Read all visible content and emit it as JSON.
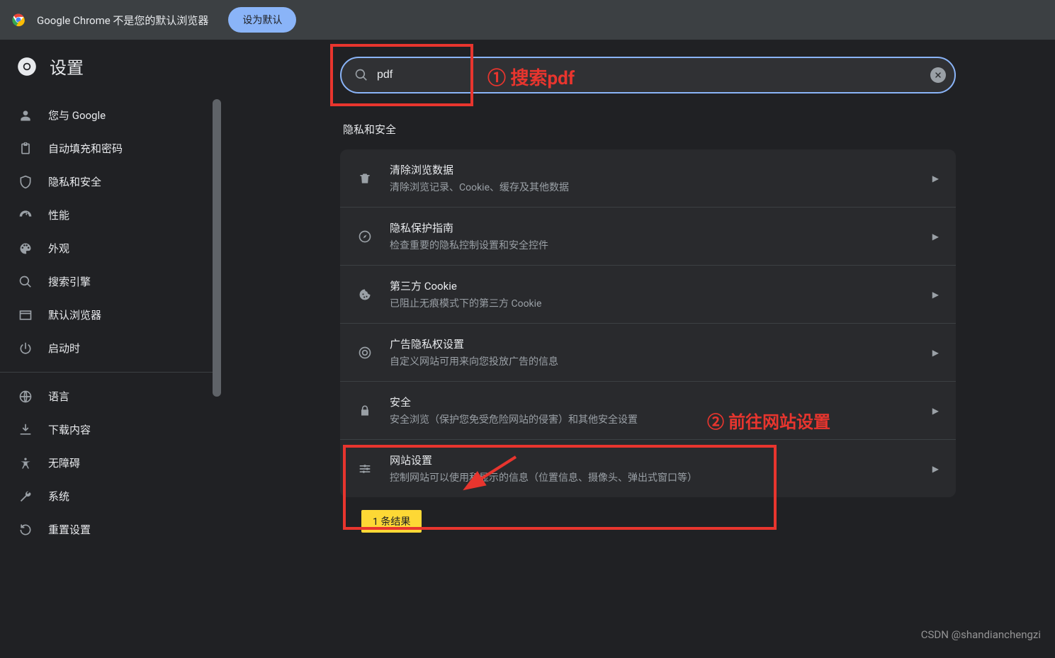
{
  "banner": {
    "text": "Google Chrome 不是您的默认浏览器",
    "button": "设为默认"
  },
  "header": {
    "title": "设置"
  },
  "sidebar": {
    "groupA": [
      {
        "icon": "person",
        "label": "您与 Google"
      },
      {
        "icon": "clipboard",
        "label": "自动填充和密码"
      },
      {
        "icon": "shield",
        "label": "隐私和安全"
      },
      {
        "icon": "gauge",
        "label": "性能"
      },
      {
        "icon": "palette",
        "label": "外观"
      },
      {
        "icon": "search",
        "label": "搜索引擎"
      },
      {
        "icon": "window",
        "label": "默认浏览器"
      },
      {
        "icon": "power",
        "label": "启动时"
      }
    ],
    "groupB": [
      {
        "icon": "globe",
        "label": "语言"
      },
      {
        "icon": "download",
        "label": "下载内容"
      },
      {
        "icon": "accessibility",
        "label": "无障碍"
      },
      {
        "icon": "wrench",
        "label": "系统"
      },
      {
        "icon": "reset",
        "label": "重置设置"
      }
    ]
  },
  "search": {
    "value": "pdf",
    "placeholder": ""
  },
  "section": {
    "title": "隐私和安全"
  },
  "rows": [
    {
      "icon": "trash",
      "title": "清除浏览数据",
      "sub": "清除浏览记录、Cookie、缓存及其他数据"
    },
    {
      "icon": "compass",
      "title": "隐私保护指南",
      "sub": "检查重要的隐私控制设置和安全控件"
    },
    {
      "icon": "cookie",
      "title": "第三方 Cookie",
      "sub": "已阻止无痕模式下的第三方 Cookie"
    },
    {
      "icon": "ads",
      "title": "广告隐私权设置",
      "sub": "自定义网站可用来向您投放广告的信息"
    },
    {
      "icon": "lock",
      "title": "安全",
      "sub": "安全浏览（保护您免受危险网站的侵害）和其他安全设置"
    },
    {
      "icon": "sliders",
      "title": "网站设置",
      "sub": "控制网站可以使用和显示的信息（位置信息、摄像头、弹出式窗口等）"
    }
  ],
  "result_tag": "1 条结果",
  "annotations": {
    "a1": "① 搜索pdf",
    "a2": "② 前往网站设置"
  },
  "watermark": "CSDN @shandianchengzi"
}
